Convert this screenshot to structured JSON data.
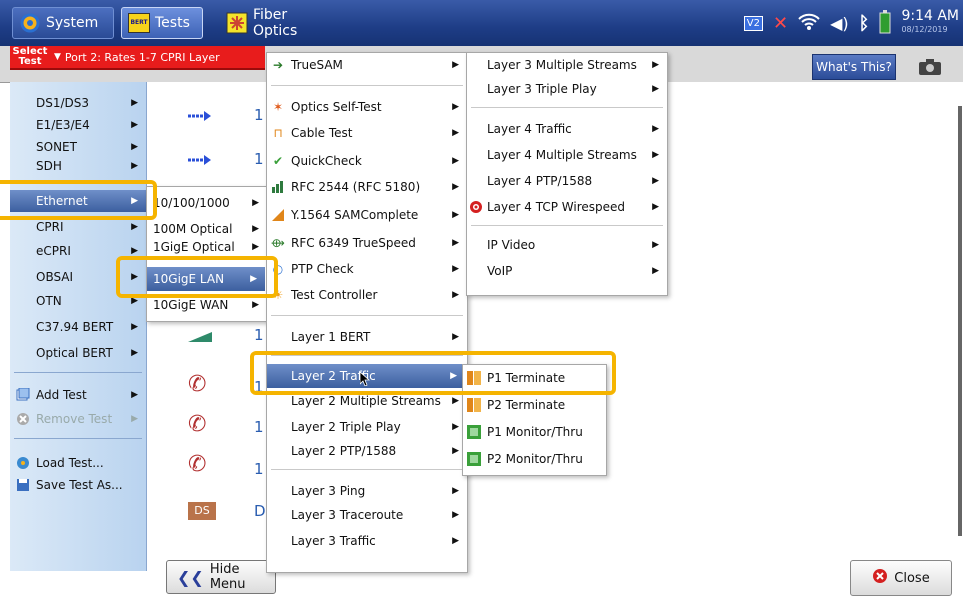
{
  "topbar": {
    "system_label": "System",
    "tests_label": "Tests",
    "tests_icon_text": "BERT",
    "fiber_label": "Fiber Optics",
    "clock_time": "9:14 AM",
    "clock_date": "08/12/2019",
    "v2_badge": "V2"
  },
  "subbar": {
    "select_test_line1": "Select",
    "select_test_line2": "Test",
    "current_test": "Port 2: Rates 1-7 CPRI Layer",
    "whats_this": "What's This?"
  },
  "sidebar": {
    "items": [
      {
        "label": "DS1/DS3"
      },
      {
        "label": "E1/E3/E4"
      },
      {
        "label": "SONET"
      },
      {
        "label": "SDH"
      },
      {
        "label": "Ethernet"
      },
      {
        "label": "CPRI"
      },
      {
        "label": "eCPRI"
      },
      {
        "label": "OBSAI"
      },
      {
        "label": "OTN"
      },
      {
        "label": "C37.94 BERT"
      },
      {
        "label": "Optical BERT"
      }
    ],
    "add_test": "Add Test",
    "remove_test": "Remove Test",
    "load_test": "Load Test...",
    "save_test": "Save Test As..."
  },
  "main": {
    "row_number": "1",
    "ds_badge": "DS",
    "ds_letter": "D",
    "hide_menu": "Hide Menu",
    "close": "Close"
  },
  "ethernet_menu": {
    "items": [
      {
        "label": "10/100/1000"
      },
      {
        "label": "100M Optical"
      },
      {
        "label": "1GigE Optical"
      },
      {
        "label": "10GigE LAN"
      },
      {
        "label": "10GigE WAN"
      }
    ]
  },
  "lan_menu": {
    "items": [
      {
        "label": "TrueSAM"
      },
      {
        "label": "Optics Self-Test"
      },
      {
        "label": "Cable Test"
      },
      {
        "label": "QuickCheck"
      },
      {
        "label": "RFC 2544 (RFC 5180)"
      },
      {
        "label": "Y.1564 SAMComplete"
      },
      {
        "label": "RFC 6349 TrueSpeed"
      },
      {
        "label": "PTP Check"
      },
      {
        "label": "Test Controller"
      },
      {
        "label": "Layer 1 BERT"
      },
      {
        "label": "Layer 2 Traffic"
      },
      {
        "label": "Layer 2 Multiple Streams"
      },
      {
        "label": "Layer 2 Triple Play"
      },
      {
        "label": "Layer 2 PTP/1588"
      },
      {
        "label": "Layer 3 Ping"
      },
      {
        "label": "Layer 3 Traceroute"
      },
      {
        "label": "Layer 3 Traffic"
      }
    ]
  },
  "layer_menu": {
    "items": [
      {
        "label": "Layer 3 Multiple Streams"
      },
      {
        "label": "Layer 3 Triple Play"
      },
      {
        "label": "Layer 4 Traffic"
      },
      {
        "label": "Layer 4 Multiple Streams"
      },
      {
        "label": "Layer 4 PTP/1588"
      },
      {
        "label": "Layer 4 TCP Wirespeed"
      },
      {
        "label": "IP Video"
      },
      {
        "label": "VoIP"
      }
    ]
  },
  "traffic_menu": {
    "items": [
      {
        "label": "P1 Terminate"
      },
      {
        "label": "P2 Terminate"
      },
      {
        "label": "P1 Monitor/Thru"
      },
      {
        "label": "P2 Monitor/Thru"
      }
    ]
  },
  "colors": {
    "topbar": "#1e3d86",
    "select_red": "#e81c1c",
    "highlight": "#f5b400",
    "selected": "#3c5f9f"
  }
}
